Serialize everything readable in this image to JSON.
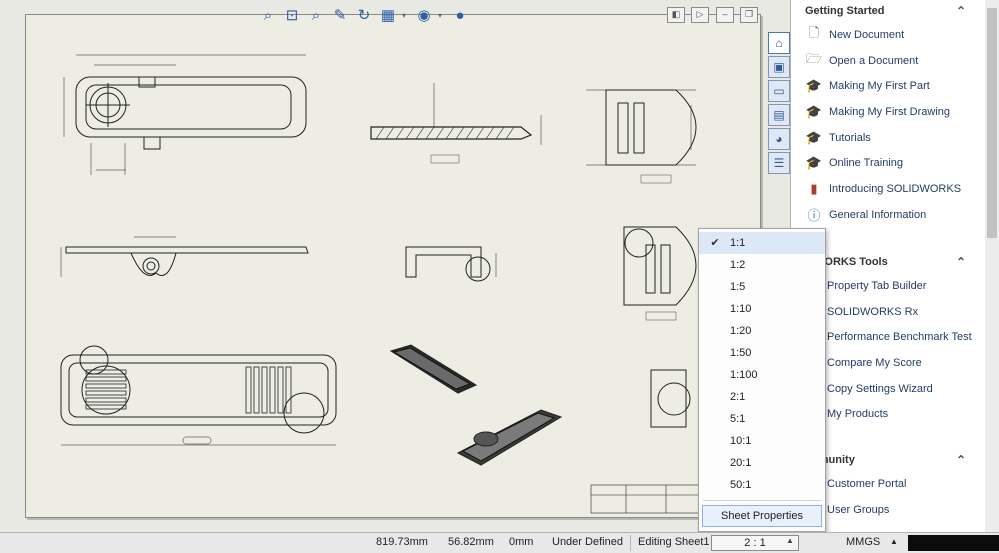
{
  "hud": {
    "icons": [
      "zoom-to-fit-icon",
      "zoom-area-icon",
      "zoom-previous-icon",
      "zoom-icon",
      "rotate-icon",
      "display-style-icon",
      "hide-show-icon",
      "appearance-icon"
    ]
  },
  "task_pane": {
    "getting_started": {
      "title": "Getting Started",
      "items": [
        {
          "label": "New Document",
          "icon": "document-icon"
        },
        {
          "label": "Open a Document",
          "icon": "open-folder-icon"
        },
        {
          "label": "Making My First Part",
          "icon": "graduation-cap-icon"
        },
        {
          "label": "Making My First Drawing",
          "icon": "graduation-cap-icon"
        },
        {
          "label": "Tutorials",
          "icon": "graduation-cap-icon"
        },
        {
          "label": "Online Training",
          "icon": "graduation-cap-icon"
        },
        {
          "label": "Introducing SOLIDWORKS",
          "icon": "book-icon"
        },
        {
          "label": "General Information",
          "icon": "info-icon"
        }
      ]
    },
    "tools": {
      "title": "IDWORKS Tools",
      "items": [
        {
          "label": "Property Tab Builder"
        },
        {
          "label": "SOLIDWORKS Rx"
        },
        {
          "label": "Performance Benchmark Test"
        },
        {
          "label": "Compare My Score"
        },
        {
          "label": "Copy Settings Wizard"
        },
        {
          "label": "My Products"
        }
      ]
    },
    "community": {
      "title": "mmunity",
      "items": [
        {
          "label": "Customer Portal"
        },
        {
          "label": "User Groups"
        }
      ]
    }
  },
  "scale_menu": {
    "options": [
      "1:1",
      "1:2",
      "1:5",
      "1:10",
      "1:20",
      "1:50",
      "1:100",
      "2:1",
      "5:1",
      "10:1",
      "20:1",
      "50:1"
    ],
    "checked": "1:1",
    "sheet_properties": "Sheet Properties"
  },
  "status_bar": {
    "x": "819.73mm",
    "y": "56.82mm",
    "z": "0mm",
    "state": "Under Defined",
    "editing": "Editing Sheet1",
    "scale": "2 : 1",
    "units": "MMGS"
  }
}
